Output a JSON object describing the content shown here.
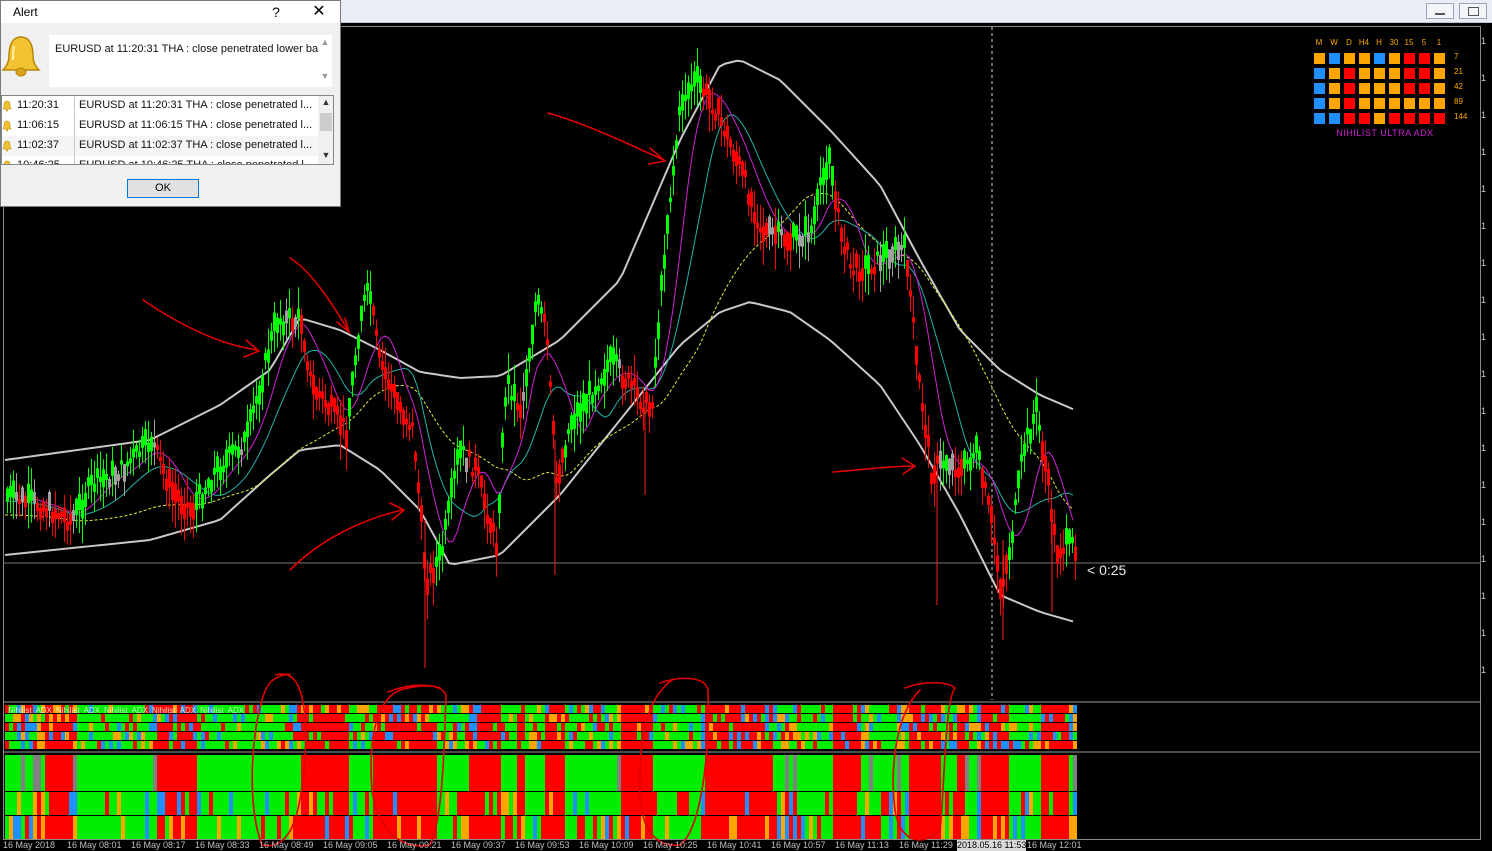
{
  "alert": {
    "title": "Alert",
    "help": "?",
    "close": "✕",
    "message": "EURUSD at 11:20:31 THA : close penetrated lower ba",
    "entries": [
      {
        "time": "11:20:31",
        "message": "EURUSD at 11:20:31 THA : close penetrated l..."
      },
      {
        "time": "11:06:15",
        "message": "EURUSD at 11:06:15 THA : close penetrated l..."
      },
      {
        "time": "11:02:37",
        "message": "EURUSD at 11:02:37 THA : close penetrated l..."
      },
      {
        "time": "10:46:25",
        "message": "EURUSD at 10:46:25 THA : close penetrated l..."
      }
    ],
    "ok_label": "OK"
  },
  "chart": {
    "countdown": "< 0:25",
    "time_labels": [
      "16 May 2018",
      "16 May 08:01",
      "16 May 08:17",
      "16 May 08:33",
      "16 May 08:49",
      "16 May 09:05",
      "16 May 09:21",
      "16 May 09:37",
      "16 May 09:53",
      "16 May 10:09",
      "16 May 10:25",
      "16 May 10:41",
      "16 May 10:57",
      "16 May 11:13",
      "16 May 11:29",
      "2018.05.16 11:53",
      "16 May 12:01"
    ],
    "indicator_label": [
      "Nihilist",
      "ADX",
      "Nihilist",
      "ADX",
      "Nihilist",
      "ADX",
      "Nihilist",
      "ADX",
      "Nihilist",
      "ADX"
    ],
    "mtf_panel": {
      "title": "NIHILIST ULTRA ADX",
      "timeframes": [
        "M",
        "W",
        "D",
        "H4",
        "H",
        "30",
        "15",
        "5",
        "1"
      ],
      "periods": [
        "7",
        "21",
        "42",
        "89",
        "144"
      ],
      "grid": [
        [
          "orange",
          "blue",
          "orange",
          "orange",
          "blue",
          "orange",
          "red",
          "red",
          "orange"
        ],
        [
          "blue",
          "orange",
          "red",
          "orange",
          "orange",
          "orange",
          "red",
          "red",
          "orange"
        ],
        [
          "blue",
          "orange",
          "red",
          "orange",
          "orange",
          "orange",
          "red",
          "red",
          "orange"
        ],
        [
          "blue",
          "orange",
          "red",
          "orange",
          "orange",
          "orange",
          "orange",
          "orange",
          "orange"
        ],
        [
          "blue",
          "blue",
          "red",
          "red",
          "orange",
          "red",
          "red",
          "red",
          "red"
        ]
      ]
    }
  },
  "colors": {
    "up": "#00ff00",
    "down": "#ff0000",
    "neutral": "#a0a0a0",
    "orange": "#ffa500",
    "blue": "#1e90ff",
    "red": "#ff0000",
    "magenta": "#d21fd7"
  }
}
